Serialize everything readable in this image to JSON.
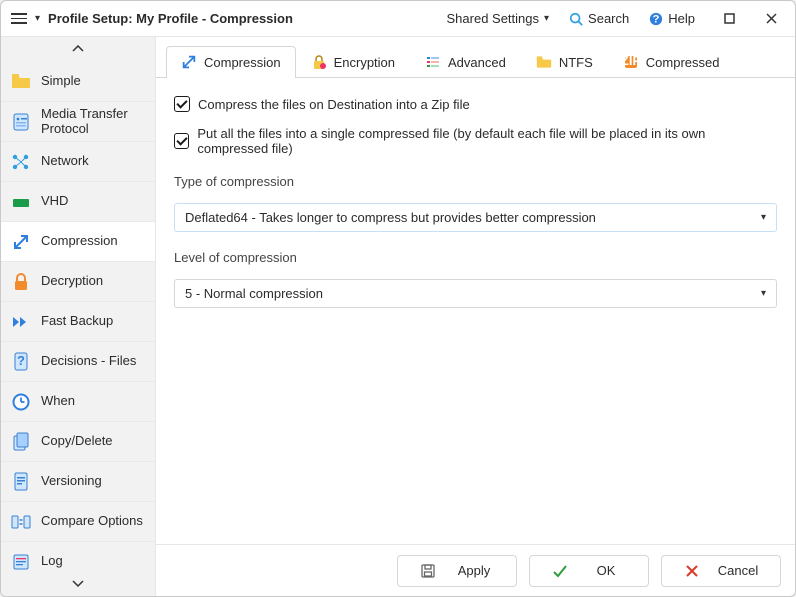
{
  "titlebar": {
    "title": "Profile Setup: My Profile - Compression",
    "shared": "Shared Settings",
    "search": "Search",
    "help": "Help"
  },
  "sidebar": {
    "items": [
      {
        "label": "Simple",
        "icon": "folder"
      },
      {
        "label": "Media Transfer Protocol",
        "icon": "mtp"
      },
      {
        "label": "Network",
        "icon": "network"
      },
      {
        "label": "VHD",
        "icon": "vhd"
      },
      {
        "label": "Compression",
        "icon": "compress",
        "selected": true
      },
      {
        "label": "Decryption",
        "icon": "lock"
      },
      {
        "label": "Fast Backup",
        "icon": "forward"
      },
      {
        "label": "Decisions - Files",
        "icon": "decision"
      },
      {
        "label": "When",
        "icon": "clock"
      },
      {
        "label": "Copy/Delete",
        "icon": "copy"
      },
      {
        "label": "Versioning",
        "icon": "version"
      },
      {
        "label": "Compare Options",
        "icon": "compare"
      },
      {
        "label": "Log",
        "icon": "log"
      }
    ]
  },
  "tabs": [
    {
      "label": "Compression",
      "icon": "compress",
      "selected": true
    },
    {
      "label": "Encryption",
      "icon": "encrypt"
    },
    {
      "label": "Advanced",
      "icon": "advanced"
    },
    {
      "label": "NTFS",
      "icon": "folder"
    },
    {
      "label": "Compressed",
      "icon": "zip"
    }
  ],
  "options": {
    "compress_destination": {
      "checked": true,
      "label": "Compress the files on Destination into a Zip file"
    },
    "single_file": {
      "checked": true,
      "label": "Put all the files into a single compressed file (by default each file will be placed in its own compressed file)"
    },
    "type_label": "Type of compression",
    "type_value": "Deflated64 - Takes longer to compress but provides better compression",
    "level_label": "Level of compression",
    "level_value": "5 - Normal compression"
  },
  "footer": {
    "apply": "Apply",
    "ok": "OK",
    "cancel": "Cancel"
  }
}
